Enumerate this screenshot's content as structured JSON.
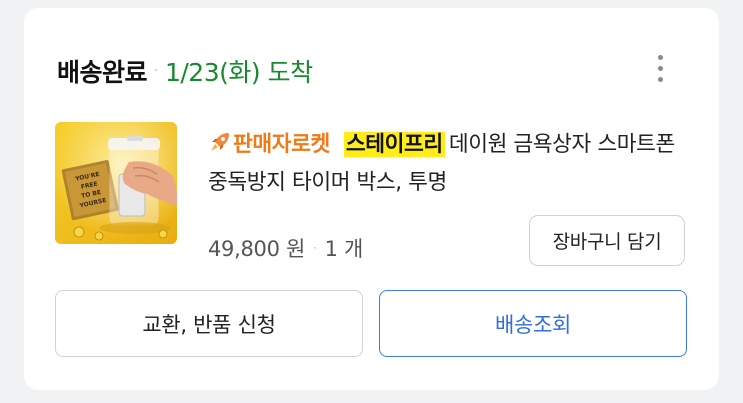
{
  "order": {
    "status": "배송완료",
    "separator": "·",
    "arrival": "1/23(화) 도착"
  },
  "menu": {
    "icon": "more-vertical-icon"
  },
  "product": {
    "image_icon": "product-thumbnail",
    "badge_icon": "rocket-icon",
    "badge_text": "판매자로켓",
    "brand": "스테이프리",
    "name": "데이원 금욕상자 스마트폰 중독방지 타이머 박스, 투명",
    "image_text": [
      "YOU'RE",
      "FREE",
      "TO BE",
      "YOURSE"
    ],
    "price": "49,800 원",
    "price_separator": "·",
    "quantity": "1 개",
    "cart_button": "장바구니 담기"
  },
  "actions": {
    "exchange_return": "교환, 반품 신청",
    "track_delivery": "배송조회"
  },
  "colors": {
    "arrival": "#178a2f",
    "badge": "#f07a16",
    "brand_highlight": "#ffec1a",
    "primary_button": "#3d7ce8",
    "thumbnail_bg": "#f2c31a"
  }
}
